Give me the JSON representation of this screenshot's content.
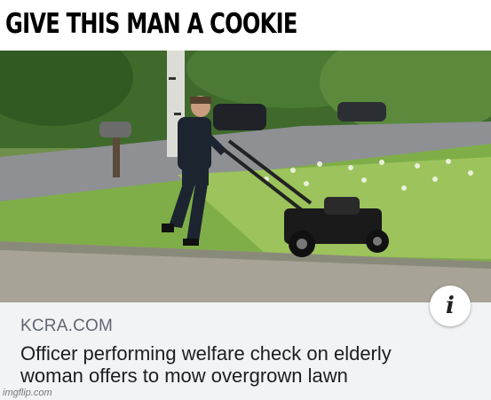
{
  "meme": {
    "caption": "GIVE THIS MAN A COOKIE"
  },
  "link_card": {
    "source": "KCRA.COM",
    "headline_line1": "Officer performing welfare check on elderly",
    "headline_line2": "woman offers to mow overgrown lawn",
    "info_icon": "info-icon",
    "info_glyph": "i"
  },
  "watermark": "imgflip.com",
  "colors": {
    "card_background": "#f2f3f5",
    "source_text": "#606770",
    "headline_text": "#1c1e21"
  }
}
